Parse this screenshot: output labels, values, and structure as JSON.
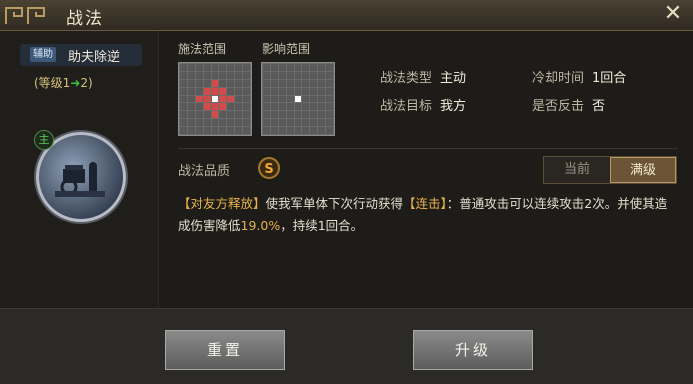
{
  "header": {
    "title": "战法",
    "close_symbol": "✕"
  },
  "skill": {
    "type_tag": "辅助",
    "name": "助夫除逆",
    "level_open": "(等级1",
    "level_arrow": "➜",
    "level_close": "2)",
    "portrait_badge": "主"
  },
  "range": {
    "cast_label": "施法范围",
    "effect_label": "影响范围"
  },
  "info": {
    "type_key": "战法类型",
    "type_val": "主动",
    "cooldown_key": "冷却时间",
    "cooldown_val": "1回合",
    "target_key": "战法目标",
    "target_val": "我方",
    "counter_key": "是否反击",
    "counter_val": "否"
  },
  "quality": {
    "label": "战法品质",
    "grade": "S"
  },
  "toggle": {
    "current": "当前",
    "max": "满级"
  },
  "description": {
    "part1": "【对友方释放】",
    "part2": "使我军单体下次行动获得",
    "part3": "【连击】",
    "part4": "：普通攻击可以连续攻击2次。并使其造成伤害降低",
    "part5": "19.0%",
    "part6": "，持续1回合。"
  },
  "buttons": {
    "reset": "重置",
    "upgrade": "升级"
  },
  "colors": {
    "accent_gold": "#e8b24a",
    "grade_orange": "#f0a63a",
    "range_red": "#d24a4a"
  }
}
